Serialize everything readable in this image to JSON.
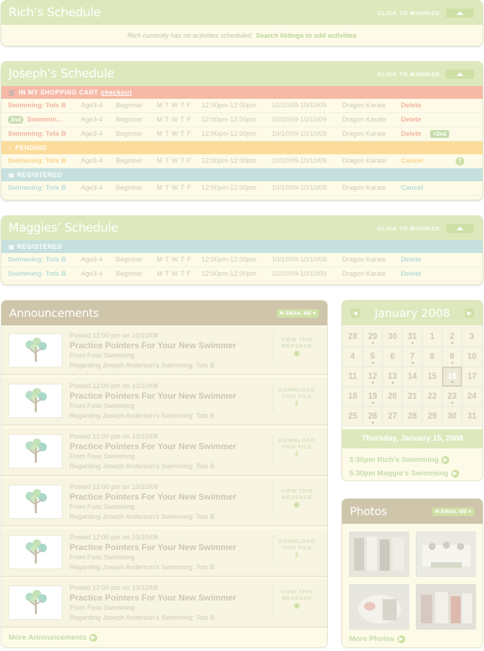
{
  "rich": {
    "title": "Rich’s Schedule",
    "minimize_label": "CLICK TO MINIMIZE",
    "empty_text": "Rich currently has no activities scheduled.",
    "empty_link": "Search listings to add activities"
  },
  "joseph": {
    "title": "Joseph’s Schedule",
    "minimize_label": "CLICK TO MINIMIZE",
    "cart_label": "IN MY SHOPPING CART",
    "checkout_label": "checkout",
    "pending_label": "PENDING",
    "registered_label": "REGISTERED",
    "cart_rows": [
      {
        "badge": "",
        "name": "Swimming: Tots B",
        "age": "Age3-4",
        "level": "Beginner",
        "days": "M T W T F",
        "time": "12:00pm-12:00pm",
        "dates": "10/10/09-10/10/09",
        "location": "Dragon Karate",
        "action": "Delete"
      },
      {
        "badge": "2nd",
        "name": "Swimmin...",
        "age": "Age3-4",
        "level": "Beginner",
        "days": "M T W T F",
        "time": "12:00pm-12:00pm",
        "dates": "10/10/09-10/10/09",
        "location": "Dragon Karate",
        "action": "Delete"
      },
      {
        "badge": "",
        "name": "Swimming: Tots B",
        "age": "Age3-4",
        "level": "Beginner",
        "days": "M T W T F",
        "time": "12:00pm-12:00pm",
        "dates": "10/10/09-10/10/09",
        "location": "Dragon Karate",
        "action": "Delete",
        "extra": "2nd"
      }
    ],
    "pending_rows": [
      {
        "name": "Swimming: Tots B",
        "age": "Age3-4",
        "level": "Beginner",
        "days": "M T W T F",
        "time": "12:00pm-12:00pm",
        "dates": "10/10/09-10/10/09",
        "location": "Dragon Karate",
        "action": "Cancel"
      }
    ],
    "registered_rows": [
      {
        "name": "Swimming: Tots B",
        "age": "Age3-4",
        "level": "Beginner",
        "days": "M T W T F",
        "time": "12:00pm-12:00pm",
        "dates": "10/10/09-10/10/09",
        "location": "Dragon Karate",
        "action": "Cancel"
      }
    ]
  },
  "maggie": {
    "title": "Maggies’ Schedule",
    "minimize_label": "CLICK TO MINIMIZE",
    "registered_label": "REGISTERED",
    "rows": [
      {
        "name": "Swimming: Tots B",
        "age": "Age3-4",
        "level": "Beginner",
        "days": "M T W T F",
        "time": "12:00pm-12:00pm",
        "dates": "10/10/09-10/10/09",
        "location": "Dragon Karate",
        "action": "Delete"
      },
      {
        "name": "Swimming: Tots B",
        "age": "Age3-4",
        "level": "Beginner",
        "days": "M T W T F",
        "time": "12:00pm-12:00pm",
        "dates": "10/10/09-10/10/09",
        "location": "Dragon Karate",
        "action": "Delete"
      }
    ]
  },
  "announcements": {
    "title": "Announcements",
    "email_label": "EMAIL ME",
    "more_label": "More Announcements",
    "items": [
      {
        "posted": "Posted 12:00 pm on 10/10/08",
        "title": "Practice Pointers For Your New Swimmer",
        "from": "From Foss Swimming",
        "regarding": "Regarding Joseph Anderson's Swimming: Tots B",
        "action_line1": "VIEW THIS",
        "action_line2": "MESSAGE",
        "action_icon": "eye-icon"
      },
      {
        "posted": "Posted 12:00 pm on 10/10/08",
        "title": "Practice Pointers For Your New Swimmer",
        "from": "From Foss Swimming",
        "regarding": "Regarding Joseph Anderson's Swimming: Tots B",
        "action_line1": "DOWNLOAD",
        "action_line2": "THIS FILE",
        "action_icon": "download-icon"
      },
      {
        "posted": "Posted 12:00 pm on 10/10/08",
        "title": "Practice Pointers For Your New Swimmer",
        "from": "From Foss Swimming",
        "regarding": "Regarding Joseph Anderson's Swimming: Tots B",
        "action_line1": "DOWNLOAD",
        "action_line2": "THIS FILE",
        "action_icon": "download-icon"
      },
      {
        "posted": "Posted 12:00 pm on 10/10/08",
        "title": "Practice Pointers For Your New Swimmer",
        "from": "From Foss Swimming",
        "regarding": "Regarding Joseph Anderson's Swimming: Tots B",
        "action_line1": "VIEW THIS",
        "action_line2": "MESSAGE",
        "action_icon": "eye-icon"
      },
      {
        "posted": "Posted 12:00 pm on 10/10/08",
        "title": "Practice Pointers For Your New Swimmer",
        "from": "From Foss Swimming",
        "regarding": "Regarding Joseph Anderson's Swimming: Tots B",
        "action_line1": "DOWNLOAD",
        "action_line2": "THIS FILE",
        "action_icon": "download-icon"
      },
      {
        "posted": "Posted 12:00 pm on 10/10/08",
        "title": "Practice Pointers For Your New Swimmer",
        "from": "From Foss Swimming",
        "regarding": "Regarding Joseph Anderson's Swimming: Tots B",
        "action_line1": "VIEW THIS",
        "action_line2": "MESSAGE",
        "action_icon": "eye-icon"
      }
    ]
  },
  "calendar": {
    "title": "January 2008",
    "days": [
      "28",
      "29",
      "30",
      "31",
      "1",
      "2",
      "3",
      "4",
      "5",
      "6",
      "7",
      "8",
      "9",
      "10",
      "11",
      "12",
      "13",
      "14",
      "15",
      "16",
      "17",
      "18",
      "19",
      "20",
      "21",
      "22",
      "23",
      "24",
      "25",
      "26",
      "27",
      "28",
      "29",
      "30",
      "31"
    ],
    "dotted": [
      1,
      3,
      5,
      8,
      10,
      12,
      15,
      16,
      19,
      22,
      26,
      29
    ],
    "today_index": 19,
    "selected_date": "Thursday, January 15, 2008",
    "events": [
      "3:30pm Rich’s Swimming",
      "5:30pm Maggie’s Swimming"
    ]
  },
  "photos": {
    "title": "Photos",
    "email_label": "EMAIL ME",
    "more_label": "More Photos"
  }
}
